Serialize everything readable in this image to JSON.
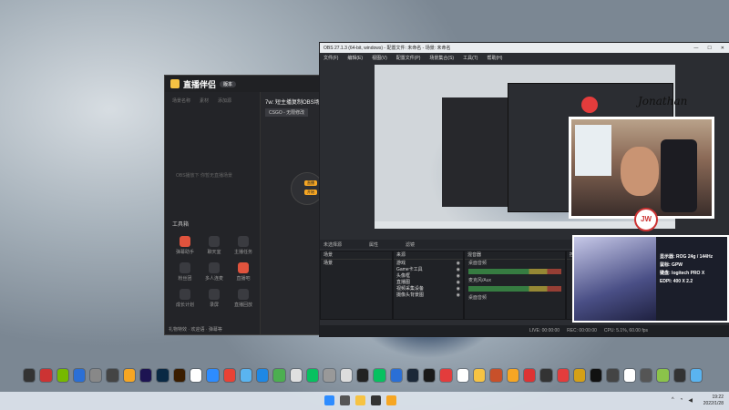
{
  "live_assistant": {
    "app_title": "直播伴侣",
    "version": "版本",
    "tabs": [
      "场景名称",
      "素材",
      "添加源"
    ],
    "empty_hint": "OBS播放下 你暂无直播场景",
    "scene_title": "7w: 短主播复制OBS场景",
    "game_tag": "CSGO - 无限修改",
    "start_btn_1": "直播",
    "start_btn_2": "开始",
    "tools_title": "工具箱",
    "tools": [
      "弹幕助手",
      "聊天室",
      "主播任务",
      "粉丝团",
      "多人连麦",
      "直播吧",
      "成长计划",
      "录屏",
      "直播回放",
      "活动",
      "快捷开播",
      "更多"
    ],
    "status_line": "礼物特效 · 欢迎语 · 弹幕等"
  },
  "obs": {
    "title": "OBS 27.1.3 (64-bit, windows) - 配置文件: 未命名 - 场景: 未命名",
    "menu": [
      "文件(F)",
      "编辑(E)",
      "视图(V)",
      "配置文件(P)",
      "场景集合(S)",
      "工具(T)",
      "帮助(H)"
    ],
    "bar_labels": [
      "未选择源",
      "属性",
      "滤镜"
    ],
    "docks": {
      "scenes": "场景",
      "sources": "来源",
      "mixer": "混音器",
      "controls": "控制"
    },
    "scene_item": "场景",
    "sources": [
      "游戏",
      "Game卡工具",
      "头像框",
      "直播图",
      "视频采集设备",
      "摄像头背景图"
    ],
    "mixer_tracks": [
      "桌面音频",
      "麦克风/Aux",
      "桌面音频"
    ],
    "status": [
      "LIVE: 00:00:00",
      "REC: 00:00:00",
      "CPU: 5.1%, 60.00 fps"
    ]
  },
  "overlay": {
    "cam_title": "Jonathan",
    "badge_text": "JW",
    "specs": [
      "显示器: ROG 24g / 144Hz",
      "鼠标: GPW",
      "键盘: logitech PRO X",
      "EDPI: 400 X 2.2"
    ]
  },
  "taskbar": {
    "time": "19:22",
    "date": "2022/1/28"
  },
  "colors": {
    "accent": "#f6a623",
    "live_red": "#e0533d"
  }
}
